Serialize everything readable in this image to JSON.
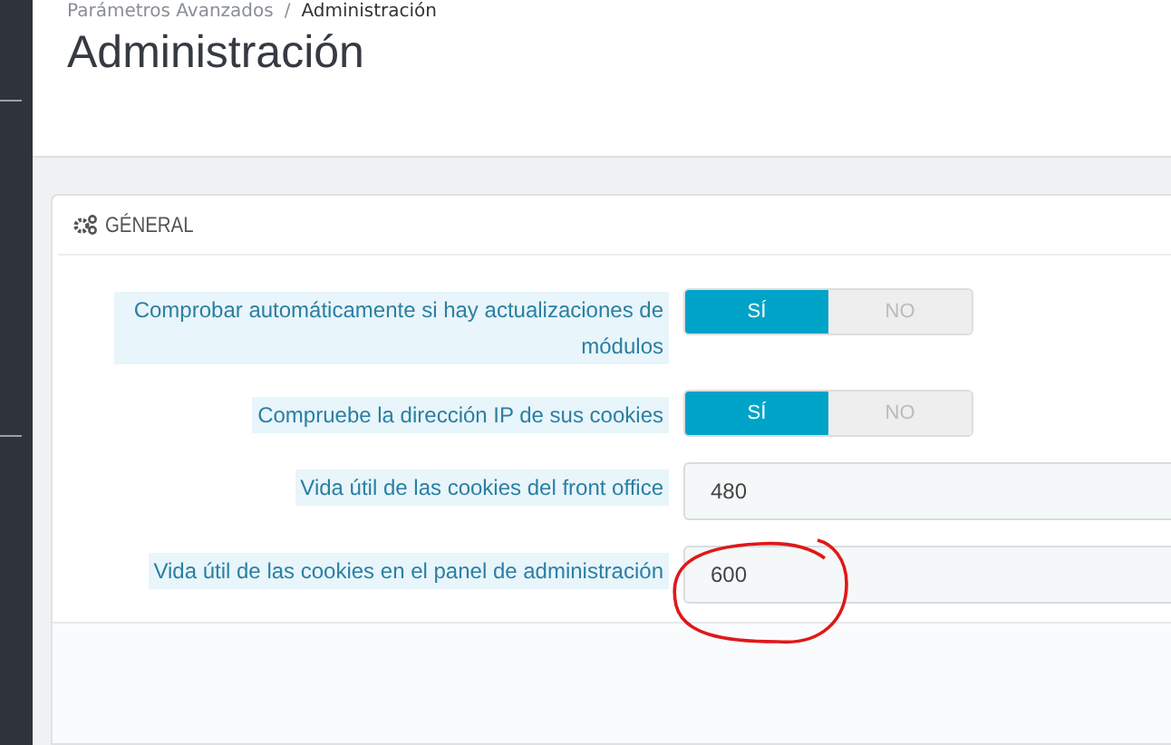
{
  "breadcrumb": [
    "Parámetros Avanzados",
    "Administración"
  ],
  "breadcrumb_separator": "/",
  "page_title": "Administración",
  "panel": {
    "title": "GÉNERAL",
    "fields": [
      {
        "kind": "switch",
        "label": "Comprobar automáticamente si hay actualizaciones de módulos",
        "on": true,
        "yes": "SÍ",
        "no": "NO"
      },
      {
        "kind": "switch",
        "label": "Compruebe la dirección IP de sus cookies",
        "on": true,
        "yes": "SÍ",
        "no": "NO"
      },
      {
        "kind": "text",
        "label": "Vida útil de las cookies del front office",
        "value": "480"
      },
      {
        "kind": "text",
        "label": "Vida útil de las cookies en el panel de administración",
        "value": "600"
      }
    ]
  }
}
